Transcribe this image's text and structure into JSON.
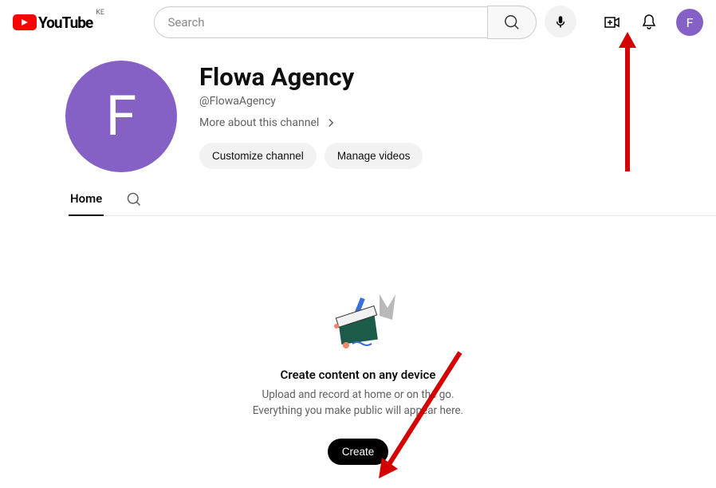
{
  "header": {
    "logo_text": "YouTube",
    "country_code": "KE",
    "search_placeholder": "Search",
    "avatar_initial": "F"
  },
  "channel": {
    "avatar_initial": "F",
    "name": "Flowa Agency",
    "handle": "@FlowaAgency",
    "more_label": "More about this channel",
    "customize_label": "Customize channel",
    "manage_label": "Manage videos"
  },
  "tabs": {
    "home": "Home"
  },
  "empty": {
    "heading": "Create content on any device",
    "line1": "Upload and record at home or on the go.",
    "line2": "Everything you make public will appear here.",
    "create_label": "Create"
  }
}
